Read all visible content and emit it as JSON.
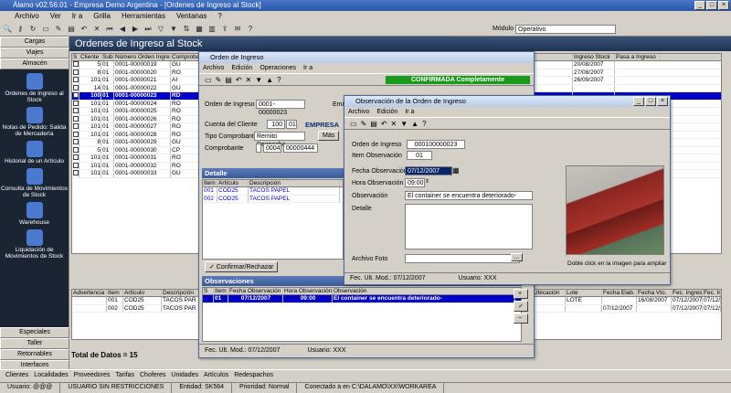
{
  "app": {
    "title": "Álamo v02.56.01 - Empresa Demo Argentina - [Ordenes de Ingreso al Stock]",
    "menu": [
      "Archivo",
      "Ver",
      "Ir a",
      "Grilla",
      "Herramientas",
      "Ventanas",
      "?"
    ],
    "modulo_label": "Módulo",
    "modulo_value": "Operativo"
  },
  "sidebar": {
    "tabs_top": [
      "Cargas",
      "Viajes",
      "Almacén"
    ],
    "items": [
      "Ordenes de Ingreso al Stock",
      "Notas de Pedido: Salida de Mercadería",
      "Historial de un Artículo",
      "Consulta de Movimientos de Stock",
      "Warehouse",
      "Liquidación de Movimientos de Stock"
    ],
    "tabs_bottom": [
      "Especiales",
      "Taller",
      "Retornables",
      "Interfaces"
    ]
  },
  "main": {
    "title": "Ordenes de Ingreso al Stock",
    "grid": {
      "headers": [
        "S",
        "Cliente",
        "Sub",
        "Número Orden Ingreso",
        "Comprobante",
        "Ingreso Stock",
        "Pasa a Ingreso"
      ],
      "rows": [
        {
          "s": "",
          "cli": "5",
          "sub": "01",
          "num": "0001-00000019",
          "comp": "GU",
          "ing": "20/08/2007"
        },
        {
          "s": "",
          "cli": "8",
          "sub": "01",
          "num": "0001-00000020",
          "comp": "RO",
          "ing": "27/08/2007"
        },
        {
          "s": "",
          "cli": "101",
          "sub": "01",
          "num": "0001-00000021",
          "comp": "AI",
          "ing": "26/09/2007"
        },
        {
          "s": "",
          "cli": "14",
          "sub": "01",
          "num": "0001-00000022",
          "comp": "GU",
          "ing": ""
        },
        {
          "s": "",
          "cli": "100",
          "sub": "01",
          "num": "0001-00000023",
          "comp": "RD",
          "ing": "",
          "sel": true
        },
        {
          "s": "",
          "cli": "101",
          "sub": "01",
          "num": "0001-00000024",
          "comp": "RO",
          "ing": ""
        },
        {
          "s": "",
          "cli": "101",
          "sub": "01",
          "num": "0001-00000025",
          "comp": "RO",
          "ing": ""
        },
        {
          "s": "",
          "cli": "101",
          "sub": "01",
          "num": "0001-00000026",
          "comp": "RO",
          "ing": ""
        },
        {
          "s": "",
          "cli": "101",
          "sub": "01",
          "num": "0001-00000027",
          "comp": "RO",
          "ing": ""
        },
        {
          "s": "",
          "cli": "101",
          "sub": "01",
          "num": "0001-00000028",
          "comp": "RO",
          "ing": ""
        },
        {
          "s": "",
          "cli": "8",
          "sub": "01",
          "num": "0001-00000029",
          "comp": "GU",
          "ing": ""
        },
        {
          "s": "",
          "cli": "5",
          "sub": "01",
          "num": "0001-00000030",
          "comp": "CP",
          "ing": ""
        },
        {
          "s": "",
          "cli": "101",
          "sub": "01",
          "num": "0001-00000031",
          "comp": "RO",
          "ing": ""
        },
        {
          "s": "",
          "cli": "101",
          "sub": "01",
          "num": "0001-00000032",
          "comp": "RO",
          "ing": ""
        },
        {
          "s": "",
          "cli": "101",
          "sub": "01",
          "num": "0001-00000033",
          "comp": "GU",
          "ing": ""
        }
      ]
    },
    "grid2": {
      "headers": [
        "Advertencia",
        "Item",
        "Artículo",
        "Descripción",
        "Ubicación",
        "Lote",
        "Fecha Elab.",
        "Fecha Vto.",
        "Fec. Ingreso",
        "Fec. Ingreso"
      ],
      "rows": [
        {
          "item": "001",
          "art": "COD25",
          "desc": "TACOS PAR",
          "lote": "LOTE",
          "elab": "",
          "vto": "16/08/2007",
          "fi": "07/12/2007",
          "fi2": "07/12/2007"
        },
        {
          "item": "002",
          "art": "COD25",
          "desc": "TACOS PAR",
          "lote": "",
          "elab": "07/12/2007",
          "vto": "",
          "fi": "07/12/2007",
          "fi2": "07/12/2007"
        }
      ]
    },
    "totals": "Total de Datos = 15"
  },
  "orden": {
    "title": "Orden de Ingreso",
    "menu": [
      "Archivo",
      "Edición",
      "Operaciones",
      "Ir a"
    ],
    "status": "CONFIRMADA Completamente",
    "orden_label": "Orden de Ingreso",
    "orden_value": "0001-00000023",
    "emi_label": "Emi",
    "cliente_label": "Cuenta del Cliente",
    "cliente_num": "100",
    "cliente_sub": "01",
    "cliente_name": "EMPRESA",
    "tipo_label": "Tipo Comprobante",
    "tipo_value": "Remito Despacho",
    "mas": "Más",
    "comp_label": "Comprobante",
    "comp_a": "0004",
    "comp_b": "00000444",
    "detalle": "Detalle",
    "det_headers": [
      "Item",
      "Artículo",
      "Descripción"
    ],
    "det_rows": [
      {
        "item": "001",
        "art": "COD25",
        "desc": "TACOS PAPEL"
      },
      {
        "item": "002",
        "art": "COD25",
        "desc": "TACOS PAPEL"
      }
    ],
    "confirm": "Confirmar/Rechazar",
    "obs": "Observaciones",
    "obs_headers": [
      "S",
      "Item",
      "Fecha Observación",
      "Hora Observación",
      "Observación"
    ],
    "obs_row": {
      "item": "01",
      "fecha": "07/12/2007",
      "hora": "09:00",
      "obs": "El container se encuentra deteriorado-"
    },
    "fec_label": "Fec. Ult. Mod.: 07/12/2007",
    "usuario": "Usuario: XXX"
  },
  "observ": {
    "title": "Observación de la Orden de Ingreso",
    "menu": [
      "Archivo",
      "Edición",
      "Ir a"
    ],
    "orden_label": "Orden de Ingreso",
    "orden_value": "000100000023",
    "item_label": "Item Observación",
    "item_value": "01",
    "fecha_label": "Fecha Observación",
    "fecha_value": "07/12/2007",
    "hora_label": "Hora Observación",
    "hora_value": "09:00",
    "obs_label": "Observación",
    "obs_value": "El container se encuentra deteriorado-",
    "detalle_label": "Detalle",
    "foto_label": "Archivo Foto",
    "foto_hint": "Doble click en la imagen para ampliar",
    "fec_label": "Fec. Ult. Mod.: 07/12/2007",
    "usuario": "Usuario: XXX"
  },
  "bottom": [
    "Clientes",
    "Localidades",
    "Proveedores",
    "Tarifas",
    "Choferes",
    "Unidades",
    "Artículos",
    "Redespachos"
  ],
  "status": [
    "Usuario: @@@",
    "USUARIO SIN RESTRICCIONES",
    "Entidad: SK564",
    "Prioridad: Normal",
    "Conectado a  en C:\\DALAMO\\XX\\WORKAREA"
  ]
}
